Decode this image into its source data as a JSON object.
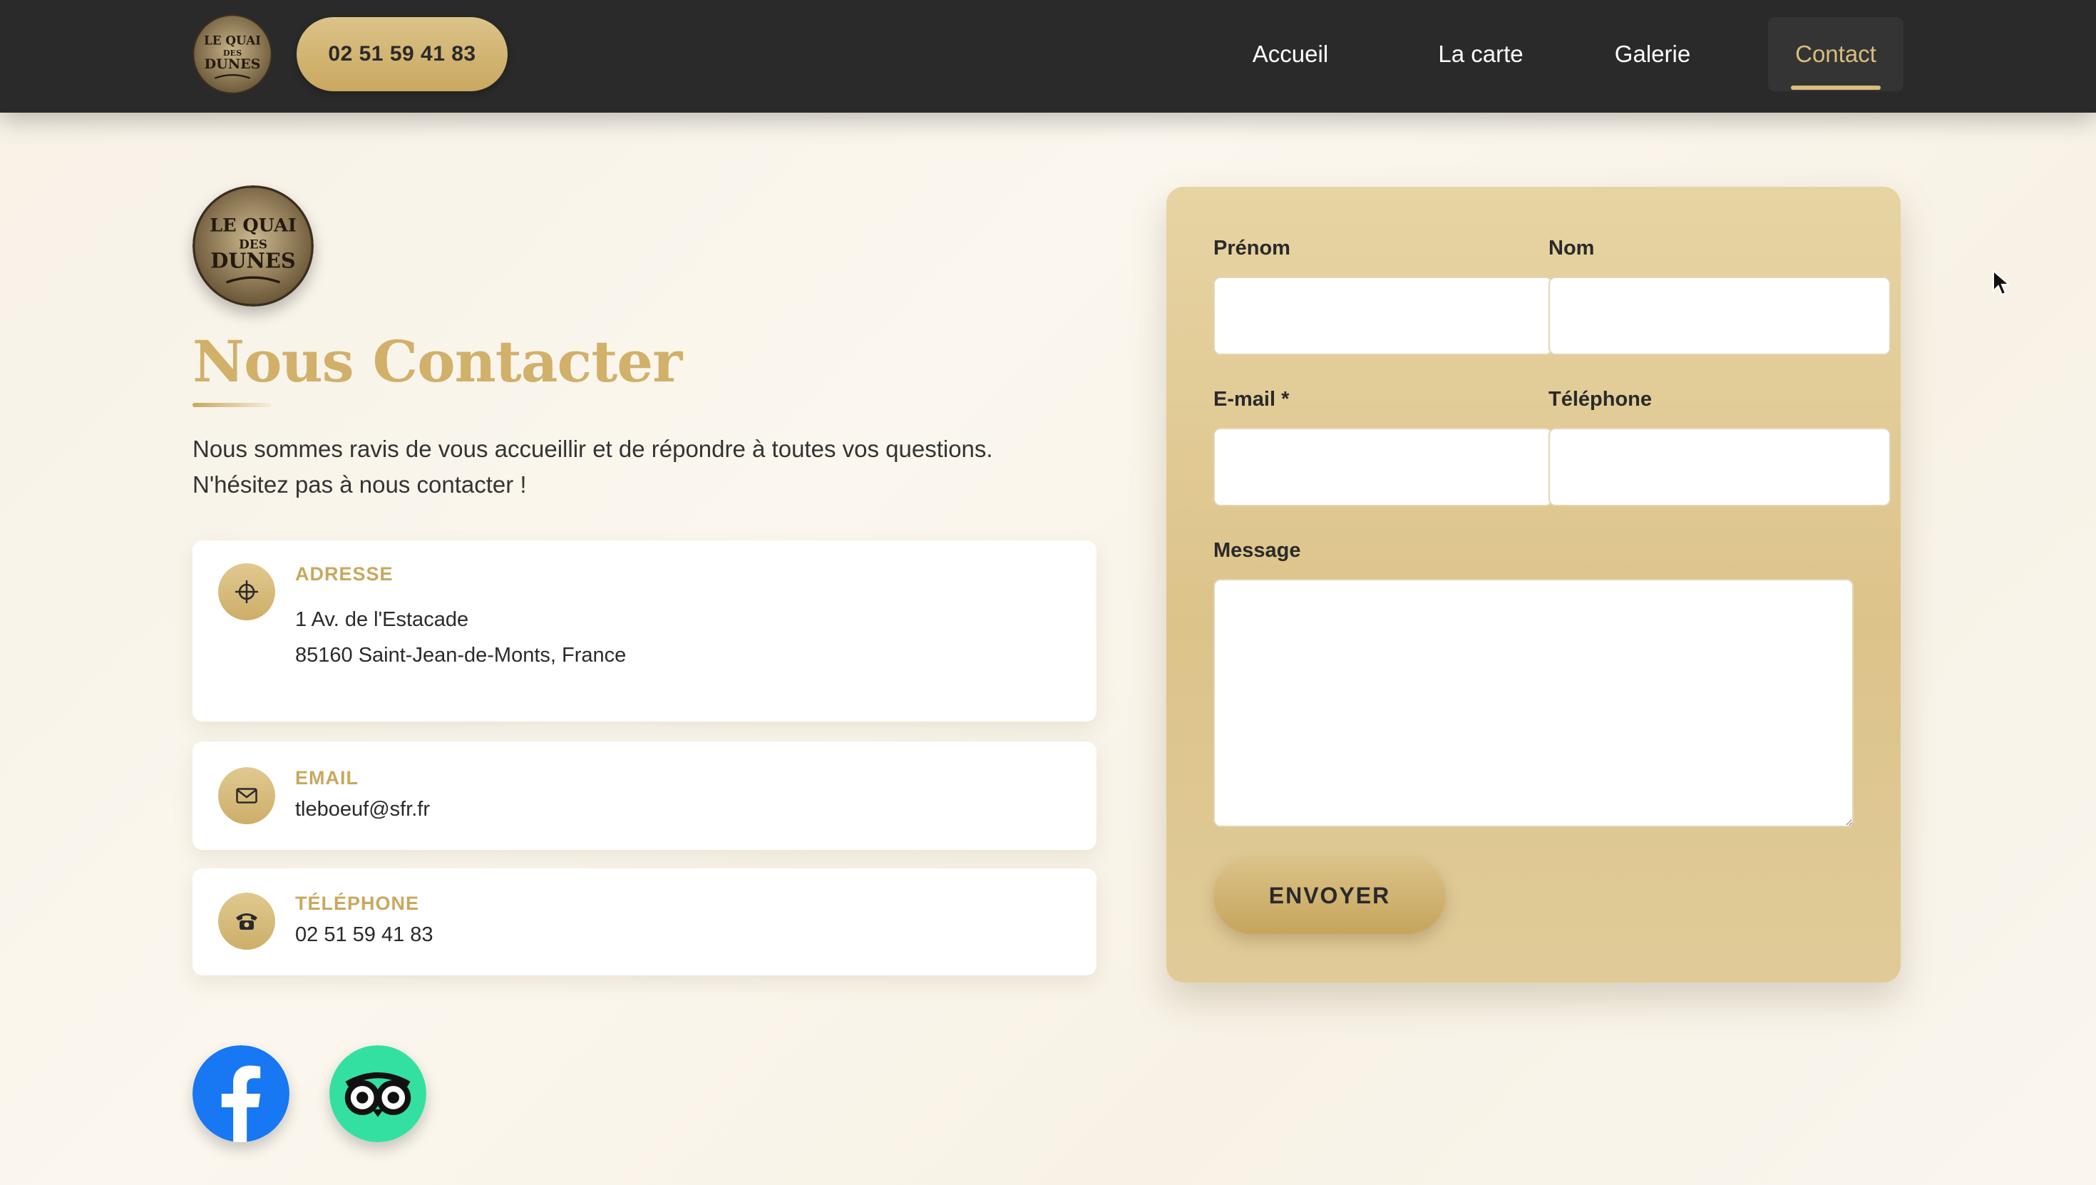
{
  "header": {
    "phone": "02 51 59 41 83",
    "nav": [
      {
        "label": "Accueil",
        "active": false
      },
      {
        "label": "La carte",
        "active": false
      },
      {
        "label": "Galerie",
        "active": false
      },
      {
        "label": "Contact",
        "active": true
      }
    ]
  },
  "logo": {
    "line1": "LE QUAI",
    "line2": "DES",
    "line3": "DUNES"
  },
  "main": {
    "title": "Nous Contacter",
    "intro_line1": "Nous sommes ravis de vous accueillir et de répondre à toutes vos questions.",
    "intro_line2": "N'hésitez pas à nous contacter !"
  },
  "cards": {
    "address": {
      "label": "ADRESSE",
      "line1": "1 Av. de l'Estacade",
      "line2": "85160 Saint-Jean-de-Monts, France",
      "icon": "crosshair-icon"
    },
    "email": {
      "label": "EMAIL",
      "value": "tleboeuf@sfr.fr",
      "icon": "envelope-icon"
    },
    "phone": {
      "label": "TÉLÉPHONE",
      "value": "02 51 59 41 83",
      "icon": "telephone-icon"
    }
  },
  "social": [
    "facebook-icon",
    "tripadvisor-icon"
  ],
  "form": {
    "first_name_label": "Prénom",
    "last_name_label": "Nom",
    "email_label": "E-mail *",
    "phone_label": "Téléphone",
    "message_label": "Message",
    "submit_label": "ENVOYER"
  },
  "colors": {
    "header_bg": "#2a2a2a",
    "gold": "#c9a85f",
    "gold_light": "#d9bd7c",
    "panel": "#e0c993",
    "facebook": "#1877f2",
    "tripadvisor": "#34e0a1"
  }
}
